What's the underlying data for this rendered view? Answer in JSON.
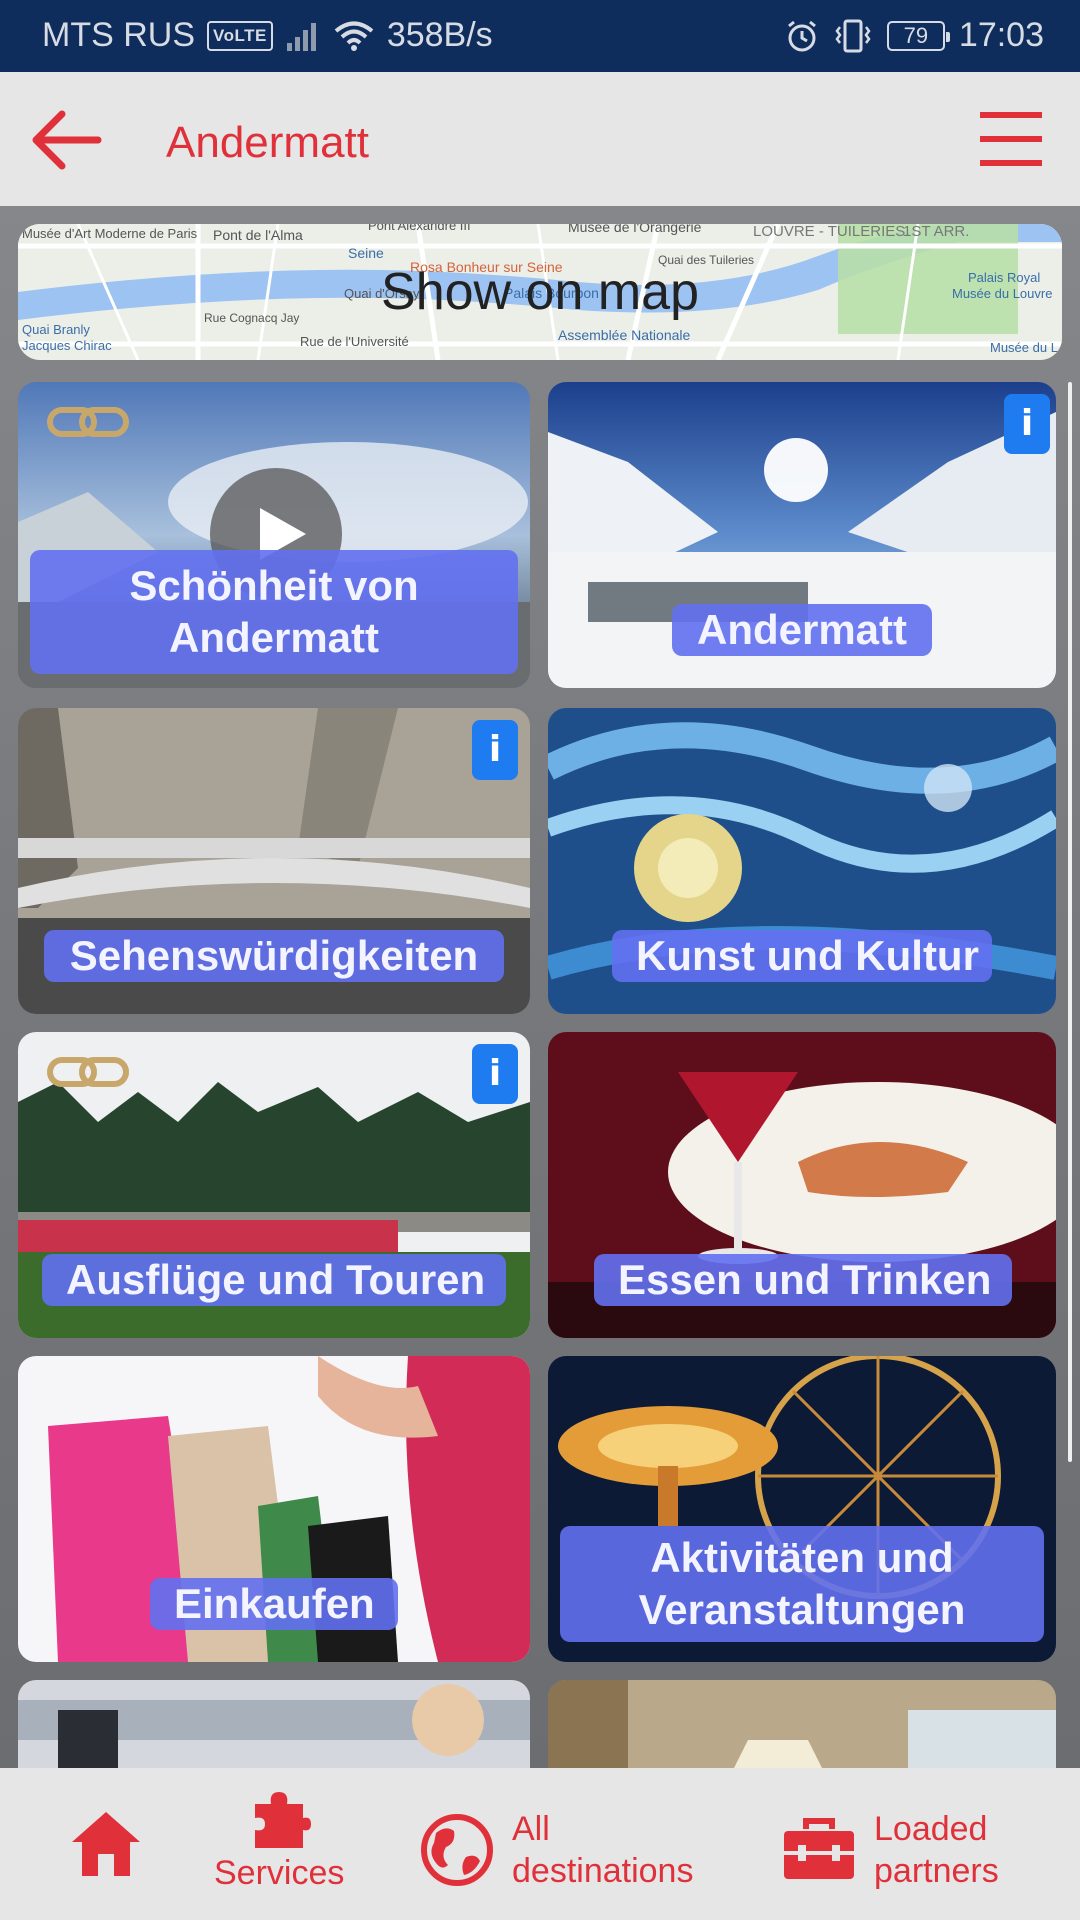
{
  "status_bar": {
    "carrier": "MTS RUS",
    "volte": "VoLTE",
    "net_speed": "358B/s",
    "battery": "79",
    "time": "17:03"
  },
  "header": {
    "title": "Andermatt",
    "back_icon": "arrow-left-icon",
    "menu_icon": "hamburger-menu-icon"
  },
  "map_banner": {
    "label": "Show on map",
    "map_labels": [
      "Musée d'Art Moderne de Paris",
      "Pont de l'Alma",
      "Pont Alexandre III",
      "Musée de l'Orangerie",
      "LOUVRE - TUILERIES",
      "1ST ARR.",
      "Seine",
      "Rosa Bonheur sur Seine",
      "Quai des Tuileries",
      "Palais Royal",
      "Musée du Louvre",
      "Quai d'Orsay",
      "Palais Bourbon",
      "Rue Cognacq Jay",
      "Quai Branly",
      "Jacques Chirac",
      "Rue de l'Université",
      "Assemblée Nationale",
      "Musée du L"
    ]
  },
  "tiles": [
    {
      "label_line1": "Schönheit von",
      "label_line2": "Andermatt",
      "has_link": true,
      "has_play": true,
      "has_info": false
    },
    {
      "label": "Andermatt",
      "has_info": true
    },
    {
      "label": "Sehenswürdigkeiten",
      "has_info": true
    },
    {
      "label": "Kunst und Kultur",
      "has_info": false
    },
    {
      "label": "Ausflüge und Touren",
      "has_link": true,
      "has_info": true
    },
    {
      "label": "Essen und Trinken",
      "has_info": false
    },
    {
      "label": "Einkaufen",
      "has_info": false
    },
    {
      "label_line1": "Aktivitäten und",
      "label_line2": "Veranstaltungen",
      "has_info": false
    }
  ],
  "info_badge": "i",
  "bottom_nav": {
    "home_icon": "home-icon",
    "services": "Services",
    "services_icon": "puzzle-icon",
    "all_destinations_line1": "All",
    "all_destinations_line2": "destinations",
    "globe_icon": "globe-icon",
    "loaded_partners_line1": "Loaded",
    "loaded_partners_line2": "partners",
    "toolbox_icon": "toolbox-icon"
  },
  "colors": {
    "accent_red": "#e0313b",
    "label_blue": "#6270f0",
    "info_blue": "#1e7cf0",
    "status_bar": "#0f2d5c"
  }
}
